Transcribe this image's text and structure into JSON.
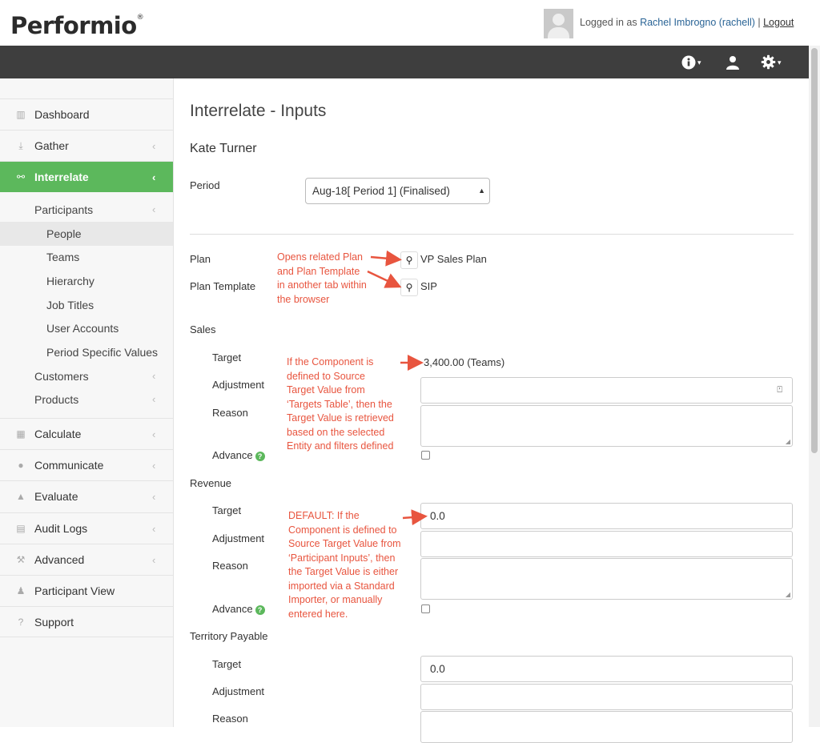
{
  "brand": {
    "name": "Performio",
    "reg": "®"
  },
  "header": {
    "logged_in_prefix": "Logged in as",
    "user": "Rachel Imbrogno (rachell)",
    "separator": "|",
    "logout": "Logout"
  },
  "navbar": {
    "icons": [
      "info-icon",
      "user-icon",
      "gear-icon"
    ]
  },
  "sidebar": {
    "items": [
      {
        "label": "Dashboard",
        "icon": "bar-chart-icon",
        "chevron": ""
      },
      {
        "label": "Gather",
        "icon": "download-icon",
        "chevron": "‹"
      },
      {
        "label": "Interrelate",
        "icon": "link-icon",
        "chevron": "‹"
      },
      {
        "label": "Calculate",
        "icon": "table-icon",
        "chevron": "‹"
      },
      {
        "label": "Communicate",
        "icon": "chat-icon",
        "chevron": "‹"
      },
      {
        "label": "Evaluate",
        "icon": "thumbs-up-icon",
        "chevron": "‹"
      },
      {
        "label": "Audit Logs",
        "icon": "file-icon",
        "chevron": "‹"
      },
      {
        "label": "Advanced",
        "icon": "wrench-icon",
        "chevron": "‹"
      },
      {
        "label": "Participant View",
        "icon": "user-icon",
        "chevron": ""
      },
      {
        "label": "Support",
        "icon": "question-icon",
        "chevron": ""
      }
    ],
    "interrelate_sub": [
      {
        "label": "Participants",
        "chevron": "‹"
      },
      {
        "label": "People"
      },
      {
        "label": "Teams"
      },
      {
        "label": "Hierarchy"
      },
      {
        "label": "Job Titles"
      },
      {
        "label": "User Accounts"
      },
      {
        "label": "Period Specific Values"
      },
      {
        "label": "Customers",
        "chevron": "‹"
      },
      {
        "label": "Products",
        "chevron": "‹"
      }
    ]
  },
  "main": {
    "title": "Interrelate - Inputs",
    "participant": "Kate Turner",
    "period": {
      "label": "Period",
      "value": "Aug-18[ Period 1] (Finalised)"
    },
    "plan": {
      "label": "Plan",
      "value": "VP Sales Plan"
    },
    "plan_template": {
      "label": "Plan Template",
      "value": "SIP"
    },
    "sections": [
      {
        "title": "Sales",
        "target_label": "Target",
        "target_value": "3,400.00 (Teams)",
        "adjustment_label": "Adjustment",
        "reason_label": "Reason",
        "advance_label": "Advance"
      },
      {
        "title": "Revenue",
        "target_label": "Target",
        "target_value": "0.0",
        "adjustment_label": "Adjustment",
        "reason_label": "Reason",
        "advance_label": "Advance"
      },
      {
        "title": "Territory Payable",
        "target_label": "Target",
        "target_value": "0.0",
        "adjustment_label": "Adjustment",
        "reason_label": "Reason"
      }
    ]
  },
  "annotations": {
    "plan_note": [
      "Opens related Plan",
      "and Plan Template",
      "in another tab within",
      "the browser"
    ],
    "sales_note": [
      "If the Component is",
      "defined to Source",
      "Target Value from",
      "‘Targets Table’, then the",
      "Target Value is retrieved",
      "based on the selected",
      "Entity and filters defined"
    ],
    "revenue_note": [
      "DEFAULT: If the",
      "Component is defined to",
      "Source Target Value from",
      "‘Participant Inputs’, then",
      "the Target Value is either",
      "imported via a Standard",
      "Importer, or manually",
      "entered here."
    ]
  },
  "colors": {
    "accent": "#5cb85c",
    "navbar": "#3e3e3e",
    "annotation": "#e8553f",
    "link": "#2a6496"
  }
}
